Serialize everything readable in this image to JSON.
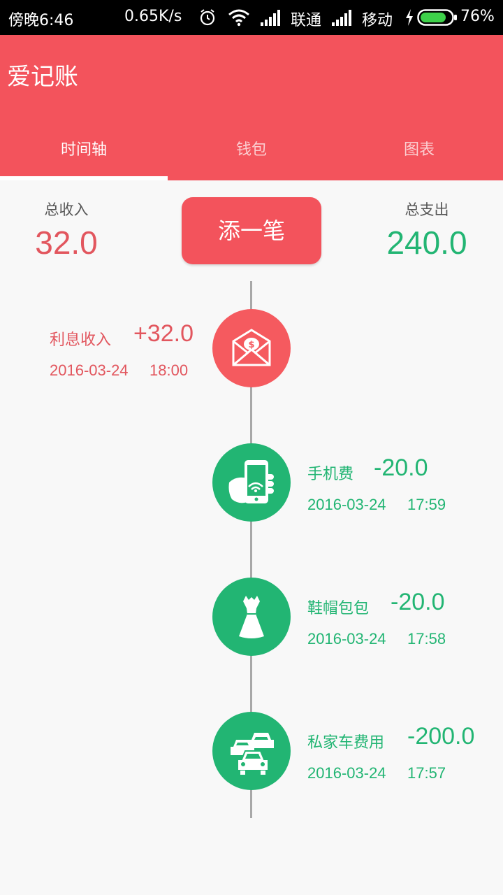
{
  "status_bar": {
    "time": "傍晚6:46",
    "speed": "0.65K/s",
    "carrier1": "联通",
    "carrier2": "移动",
    "battery": "76%"
  },
  "app": {
    "title": "爱记账"
  },
  "tabs": [
    {
      "label": "时间轴",
      "selected": true
    },
    {
      "label": "钱包",
      "selected": false
    },
    {
      "label": "图表",
      "selected": false
    }
  ],
  "summary": {
    "income_label": "总收入",
    "income_value": "32.0",
    "expense_label": "总支出",
    "expense_value": "240.0",
    "add_button": "添一笔"
  },
  "entries": [
    {
      "name": "利息收入",
      "amount": "+32.0",
      "date": "2016-03-24",
      "time": "18:00",
      "icon": "money-envelope-icon"
    },
    {
      "name": "手机费",
      "amount": "-20.0",
      "date": "2016-03-24",
      "time": "17:59",
      "icon": "phone-in-hand-icon"
    },
    {
      "name": "鞋帽包包",
      "amount": "-20.0",
      "date": "2016-03-24",
      "time": "17:58",
      "icon": "dress-icon"
    },
    {
      "name": "私家车费用",
      "amount": "-200.0",
      "date": "2016-03-24",
      "time": "17:57",
      "icon": "cars-icon"
    }
  ],
  "colors": {
    "income": "#e2565e",
    "expense": "#22b573",
    "primary": "#f3535c"
  }
}
